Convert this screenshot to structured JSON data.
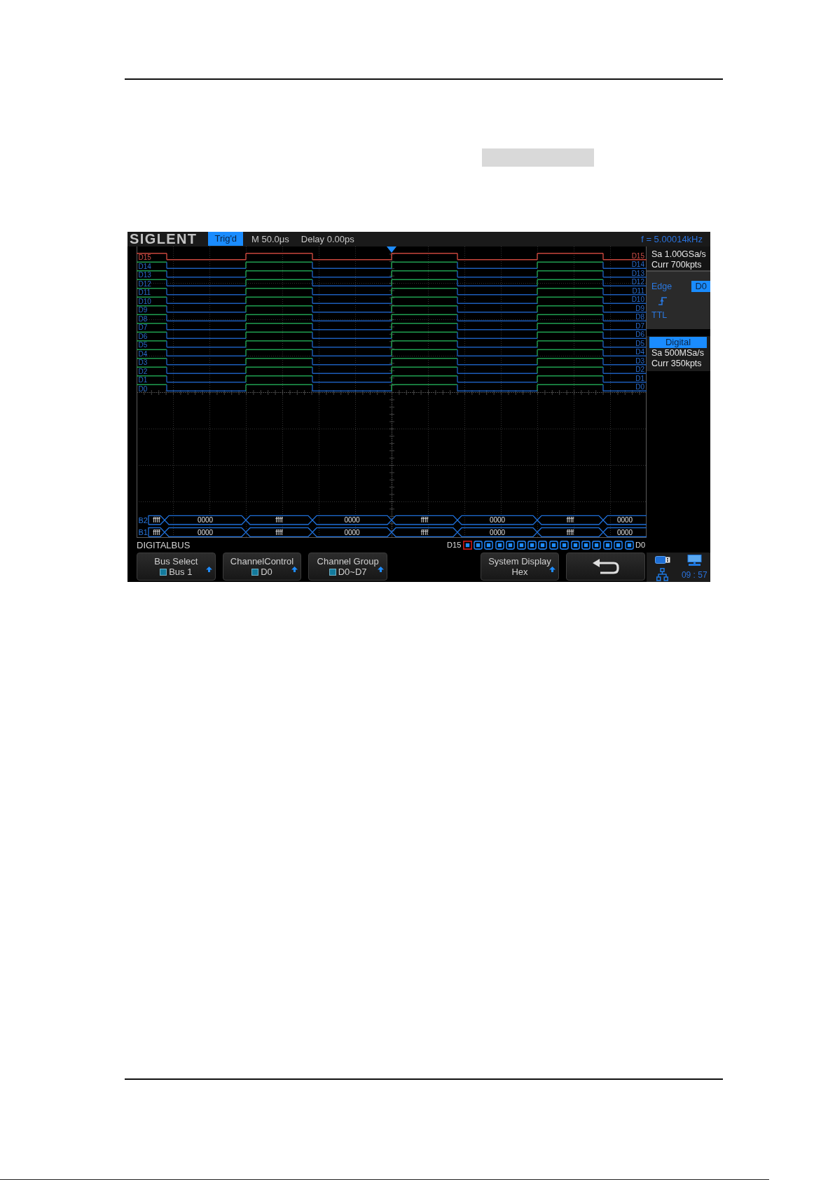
{
  "top_bar": {
    "logo": "SIGLENT",
    "trigger_status": "Trig'd",
    "timebase": "M 50.0μs",
    "delay": "Delay 0.00ps",
    "frequency": "f = 5.00014kHz"
  },
  "channels": [
    {
      "left_label": "D15",
      "right_label": "D15",
      "selected": true
    },
    {
      "left_label": "D14",
      "right_label": "D14",
      "selected": false
    },
    {
      "left_label": "D13",
      "right_label": "D13",
      "selected": false
    },
    {
      "left_label": "D12",
      "right_label": "D12",
      "selected": false
    },
    {
      "left_label": "D11",
      "right_label": "D11",
      "selected": false
    },
    {
      "left_label": "D10",
      "right_label": "D10",
      "selected": false
    },
    {
      "left_label": "D9",
      "right_label": "D9",
      "selected": false
    },
    {
      "left_label": "D8",
      "right_label": "D8",
      "selected": false
    },
    {
      "left_label": "D7",
      "right_label": "D7",
      "selected": false
    },
    {
      "left_label": "D6",
      "right_label": "D6",
      "selected": false
    },
    {
      "left_label": "D5",
      "right_label": "D5",
      "selected": false
    },
    {
      "left_label": "D4",
      "right_label": "D4",
      "selected": false
    },
    {
      "left_label": "D3",
      "right_label": "D3",
      "selected": false
    },
    {
      "left_label": "D2",
      "right_label": "D2",
      "selected": false
    },
    {
      "left_label": "D1",
      "right_label": "D1",
      "selected": false
    },
    {
      "left_label": "D0",
      "right_label": "D0",
      "selected": false
    }
  ],
  "buses": [
    {
      "label": "B2",
      "values": [
        "ffff",
        "0000",
        "ffff",
        "0000",
        "ffff",
        "0000",
        "ffff",
        "0000"
      ]
    },
    {
      "label": "B1",
      "values": [
        "ffff",
        "0000",
        "ffff",
        "0000",
        "ffff",
        "0000",
        "ffff",
        "0000"
      ]
    }
  ],
  "acquisition_panel": {
    "sample_rate": "Sa 1.00GSa/s",
    "memory_depth": "Curr 700kpts"
  },
  "trigger_panel": {
    "type": "Edge",
    "source": "D0",
    "threshold": "TTL"
  },
  "digital_panel": {
    "title": "Digital",
    "sample_rate": "Sa 500MSa/s",
    "memory_depth": "Curr 350kpts"
  },
  "menu_title": "DIGITALBUS",
  "channel_indicators": {
    "first_label": "D15",
    "last_label": "D0",
    "items": [
      {
        "selected": true
      },
      {
        "selected": false
      },
      {
        "selected": false
      },
      {
        "selected": false
      },
      {
        "selected": false
      },
      {
        "selected": false
      },
      {
        "selected": false
      },
      {
        "selected": false
      },
      {
        "selected": false
      },
      {
        "selected": false
      },
      {
        "selected": false
      },
      {
        "selected": false
      },
      {
        "selected": false
      },
      {
        "selected": false
      },
      {
        "selected": false
      },
      {
        "selected": false
      }
    ]
  },
  "softkeys": [
    {
      "kind": "option",
      "label": "Bus Select",
      "value": "Bus 1",
      "swatch": true
    },
    {
      "kind": "option",
      "label": "ChannelControl",
      "value": "D0",
      "swatch": true
    },
    {
      "kind": "option",
      "label": "Channel Group",
      "value": "D0~D7",
      "swatch": true
    },
    {
      "kind": "blank"
    },
    {
      "kind": "option",
      "label": "System Display",
      "value": "Hex",
      "swatch": false
    },
    {
      "kind": "back"
    }
  ],
  "status": {
    "time": "09 : 57"
  }
}
